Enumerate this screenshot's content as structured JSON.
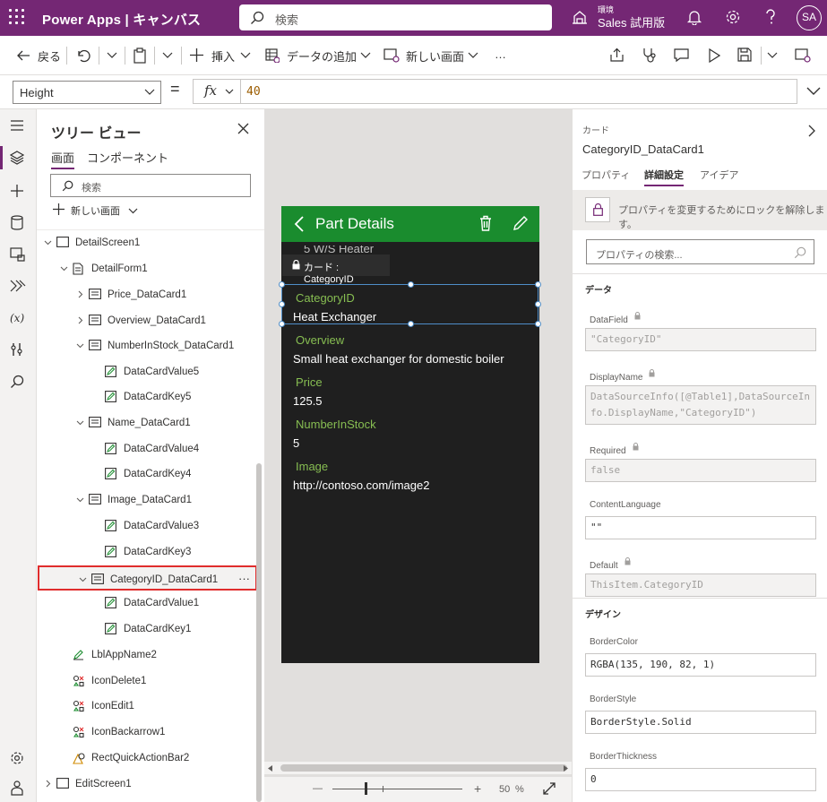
{
  "app": {
    "name": "Power Apps | キャンバス",
    "search_placeholder": "検索",
    "env_label": "環境",
    "env_name": "Sales 試用版",
    "avatar": "SA"
  },
  "toolbar": {
    "back": "戻る",
    "insert": "挿入",
    "add_data": "データの追加",
    "new_screen": "新しい画面",
    "more": "…"
  },
  "formula_bar": {
    "property": "Height",
    "equals": "=",
    "fx": "fx",
    "value": "40"
  },
  "tree": {
    "title": "ツリー ビュー",
    "tabs": [
      "画面",
      "コンポーネント"
    ],
    "search_placeholder": "検索",
    "new_screen": "新しい画面",
    "nodes": [
      {
        "label": "DetailScreen1"
      },
      {
        "label": "DetailForm1"
      },
      {
        "label": "Price_DataCard1"
      },
      {
        "label": "Overview_DataCard1"
      },
      {
        "label": "NumberInStock_DataCard1"
      },
      {
        "label": "DataCardValue5"
      },
      {
        "label": "DataCardKey5"
      },
      {
        "label": "Name_DataCard1"
      },
      {
        "label": "DataCardValue4"
      },
      {
        "label": "DataCardKey4"
      },
      {
        "label": "Image_DataCard1"
      },
      {
        "label": "DataCardValue3"
      },
      {
        "label": "DataCardKey3"
      },
      {
        "label": "CategoryID_DataCard1"
      },
      {
        "label": "DataCardValue1"
      },
      {
        "label": "DataCardKey1"
      },
      {
        "label": "LblAppName2"
      },
      {
        "label": "IconDelete1"
      },
      {
        "label": "IconEdit1"
      },
      {
        "label": "IconBackarrow1"
      },
      {
        "label": "RectQuickActionBar2"
      },
      {
        "label": "EditScreen1"
      }
    ],
    "selected_more": "···"
  },
  "canvas": {
    "header_title": "Part Details",
    "partial_text": "5 W/S Heater",
    "tooltip": "カード : CategoryID",
    "fields": [
      {
        "label": "CategoryID",
        "value": "Heat Exchanger"
      },
      {
        "label": "Overview",
        "value": "Small heat exchanger for domestic boiler"
      },
      {
        "label": "Price",
        "value": "125.5"
      },
      {
        "label": "NumberInStock",
        "value": "5"
      },
      {
        "label": "Image",
        "value": "http://contoso.com/image2"
      }
    ],
    "zoom_value": "50",
    "zoom_unit": "%",
    "zoom_minus": "—",
    "zoom_plus": "+"
  },
  "props": {
    "category": "カード",
    "name": "CategoryID_DataCard1",
    "tabs": [
      "プロパティ",
      "詳細設定",
      "アイデア"
    ],
    "lock_message": "プロパティを変更するためにロックを解除します。",
    "search_placeholder": "プロパティの検索...",
    "section_data": "データ",
    "section_design": "デザイン",
    "data": [
      {
        "label": "DataField",
        "value": "\"CategoryID\""
      },
      {
        "label": "DisplayName",
        "value": "DataSourceInfo([@Table1],DataSourceInfo.DisplayName,\"CategoryID\")"
      },
      {
        "label": "Required",
        "value": "false"
      },
      {
        "label": "ContentLanguage",
        "value": "\"\""
      },
      {
        "label": "Default",
        "value": "ThisItem.CategoryID"
      }
    ],
    "design": [
      {
        "label": "BorderColor",
        "value": "RGBA(135, 190, 82, 1)"
      },
      {
        "label": "BorderStyle",
        "value": "BorderStyle.Solid"
      },
      {
        "label": "BorderThickness",
        "value": "0"
      }
    ]
  }
}
